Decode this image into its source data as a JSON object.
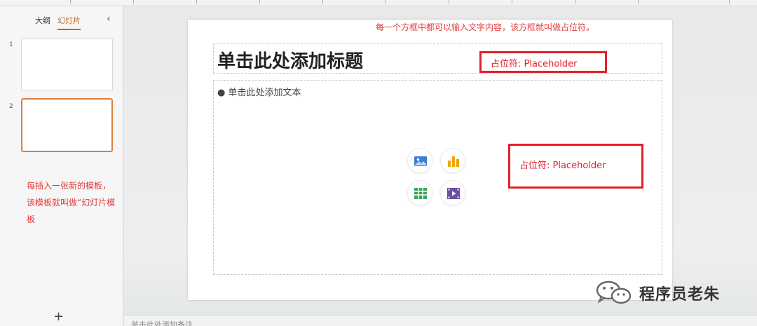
{
  "sidebar": {
    "tabs": [
      {
        "label": "大纲"
      },
      {
        "label": "幻灯片"
      }
    ],
    "collapse_glyph": "‹",
    "thumbnails": [
      {
        "number": "1"
      },
      {
        "number": "2"
      }
    ],
    "annotation": "每插入一张新的模板，该模板就叫做“幻灯片模板",
    "add_glyph": "+"
  },
  "slide": {
    "top_annotation": "每一个方框中都可以输入文字内容，该方框就叫做占位符。",
    "title_placeholder": "单击此处添加标题",
    "body_placeholder": "● 单击此处添加文本",
    "callouts": [
      {
        "label": "占位符: Placeholder"
      },
      {
        "label": "占位符: Placeholder"
      }
    ],
    "insert_buttons": [
      {
        "icon": "picture-icon",
        "color": "#3b7dd8"
      },
      {
        "icon": "chart-icon",
        "color": "#f0a30a"
      },
      {
        "icon": "table-icon",
        "color": "#3aa757"
      },
      {
        "icon": "video-icon",
        "color": "#6b4fa0"
      }
    ]
  },
  "notes": {
    "placeholder": "单击此处添加备注"
  },
  "watermark": {
    "text": "程序员老朱"
  },
  "colors": {
    "accent": "#d0621b",
    "annotation_red": "#e3202a"
  }
}
